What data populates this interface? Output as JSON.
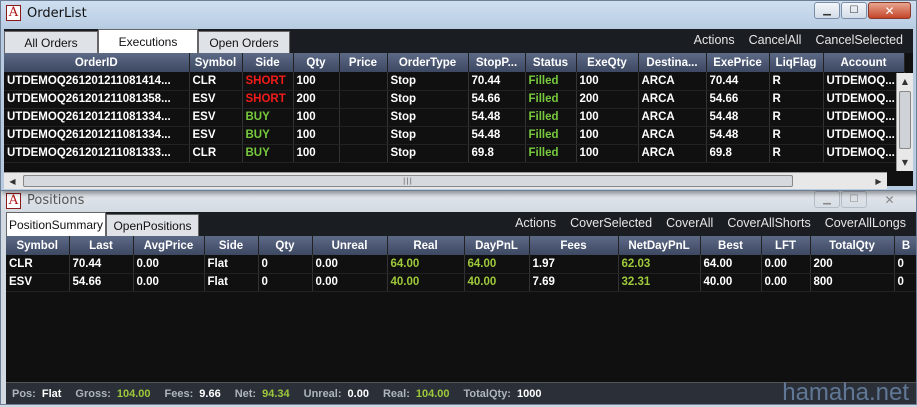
{
  "orderlist": {
    "title": "OrderList",
    "tabs": [
      "All Orders",
      "Executions",
      "Open Orders"
    ],
    "actions": [
      "Actions",
      "CancelAll",
      "CancelSelected"
    ],
    "columns": [
      "OrderID",
      "Symbol",
      "Side",
      "Qty",
      "Price",
      "OrderType",
      "StopP...",
      "Status",
      "ExeQty",
      "Destina...",
      "ExePrice",
      "LiqFlag",
      "Account"
    ],
    "rows": [
      [
        "UTDEMOQ261201211081414...",
        "CLR",
        "SHORT",
        "100",
        "",
        "Stop",
        "70.44",
        "Filled",
        "100",
        "ARCA",
        "70.44",
        "R",
        "UTDEMOQ..."
      ],
      [
        "UTDEMOQ261201211081358...",
        "ESV",
        "SHORT",
        "200",
        "",
        "Stop",
        "54.66",
        "Filled",
        "200",
        "ARCA",
        "54.66",
        "R",
        "UTDEMOQ..."
      ],
      [
        "UTDEMOQ261201211081334...",
        "ESV",
        "BUY",
        "100",
        "",
        "Stop",
        "54.48",
        "Filled",
        "100",
        "ARCA",
        "54.48",
        "R",
        "UTDEMOQ..."
      ],
      [
        "UTDEMOQ261201211081334...",
        "ESV",
        "BUY",
        "100",
        "",
        "Stop",
        "54.48",
        "Filled",
        "100",
        "ARCA",
        "54.48",
        "R",
        "UTDEMOQ..."
      ],
      [
        "UTDEMOQ261201211081333...",
        "CLR",
        "BUY",
        "100",
        "",
        "Stop",
        "69.8",
        "Filled",
        "100",
        "ARCA",
        "69.8",
        "R",
        "UTDEMOQ..."
      ]
    ]
  },
  "positions": {
    "title": "Positions",
    "tabs": [
      "PositionSummary",
      "OpenPositions"
    ],
    "actions": [
      "Actions",
      "CoverSelected",
      "CoverAll",
      "CoverAllShorts",
      "CoverAllLongs"
    ],
    "columns": [
      "Symbol",
      "Last",
      "AvgPrice",
      "Side",
      "Qty",
      "Unreal",
      "Real",
      "DayPnL",
      "Fees",
      "NetDayPnL",
      "Best",
      "LFT",
      "TotalQty",
      "B"
    ],
    "rows": [
      [
        "CLR",
        "70.44",
        "0.00",
        "Flat",
        "0",
        "0.00",
        "64.00",
        "64.00",
        "1.97",
        "62.03",
        "64.00",
        "0.00",
        "200",
        "0"
      ],
      [
        "ESV",
        "54.66",
        "0.00",
        "Flat",
        "0",
        "0.00",
        "40.00",
        "40.00",
        "7.69",
        "32.31",
        "40.00",
        "0.00",
        "800",
        "0"
      ]
    ],
    "status": {
      "pos_label": "Pos:",
      "pos": "Flat",
      "gross_label": "Gross:",
      "gross": "104.00",
      "fees_label": "Fees:",
      "fees": "9.66",
      "net_label": "Net:",
      "net": "94.34",
      "unreal_label": "Unreal:",
      "unreal": "0.00",
      "real_label": "Real:",
      "real": "104.00",
      "totalqty_label": "TotalQty:",
      "totalqty": "1000"
    }
  },
  "window_controls": {
    "minimize": "▁",
    "maximize": "☐",
    "close": "✕"
  },
  "watermark": "hamaha.net",
  "colors": {
    "short": "#f21b1b",
    "buy": "#77c93d",
    "filled": "#77c93d",
    "profit": "#9ec93a"
  }
}
